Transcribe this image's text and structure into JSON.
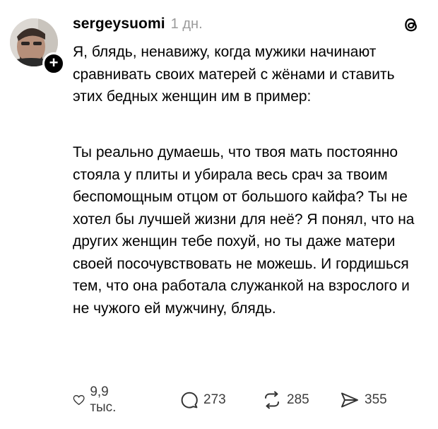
{
  "post": {
    "username": "sergeysuomi",
    "time": "1 дн.",
    "paragraphs": [
      "Я, блядь, ненавижу, когда мужики начинают сравнивать своих матерей с жёнами и ставить этих бедных женщин им в пример:",
      "Ты реально думаешь, что твоя мать постоянно стояла у плиты и убирала весь срач за твоим беспомощным отцом от большого кайфа? Ты не хотел бы лучшей жизни для неё? Я понял, что на других женщин тебе похуй, но ты даже матери своей посочувствовать не можешь. И гордишься тем, что она работала служанкой на взрослого и не чужого ей мужчину, блядь."
    ],
    "follow_badge": "+"
  },
  "actions": {
    "likes": "9,9 тыс.",
    "comments": "273",
    "reposts": "285",
    "shares": "355"
  },
  "icons": {
    "avatar": "user-avatar",
    "follow": "plus-icon",
    "app": "threads-logo-icon",
    "like": "heart-icon",
    "comment": "comment-bubble-icon",
    "repost": "repost-icon",
    "share": "send-icon"
  }
}
